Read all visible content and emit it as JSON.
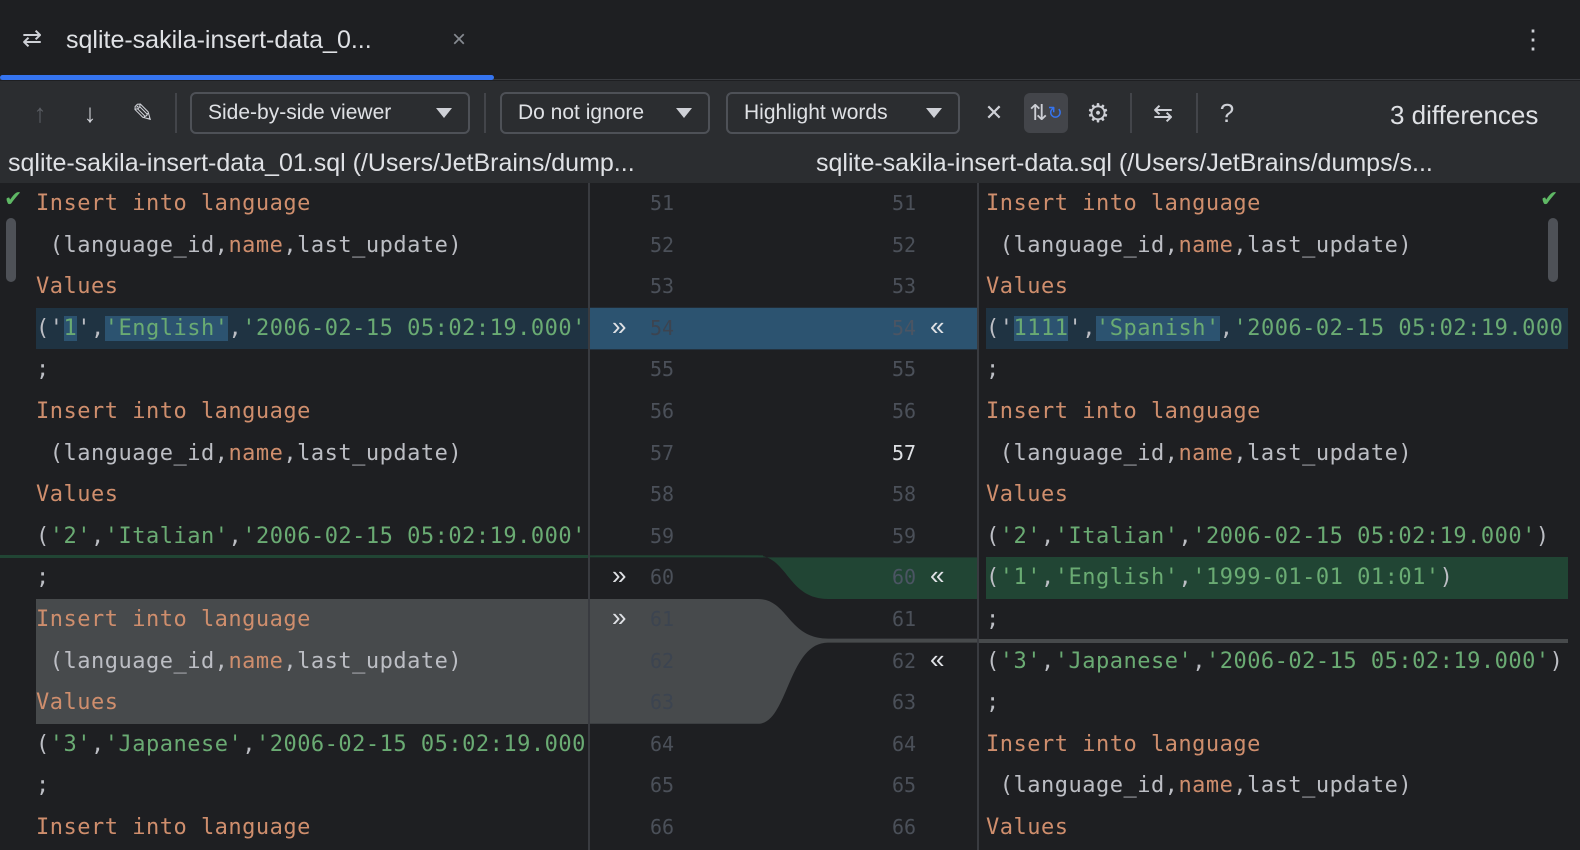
{
  "tab": {
    "title": "sqlite-sakila-insert-data_0...",
    "icon": "diff-arrows-icon",
    "close": "×"
  },
  "toolbar": {
    "viewer": "Side-by-side viewer",
    "ignore": "Do not ignore",
    "highlight": "Highlight words",
    "help": "?",
    "differences": "3 differences"
  },
  "files": {
    "left": "sqlite-sakila-insert-data_01.sql (/Users/JetBrains/dump...",
    "right": "sqlite-sakila-insert-data.sql (/Users/JetBrains/dumps/s..."
  },
  "colors": {
    "keyword": "#cf8e6d",
    "string": "#6aab73",
    "text": "#bcbec4",
    "modified": "#2c5370",
    "inserted": "#214534",
    "deleted": "#474a4c",
    "accent": "#3574f0"
  },
  "left_lines": [
    {
      "n": "51",
      "tokens": [
        [
          "k",
          "Insert into language"
        ]
      ]
    },
    {
      "n": "52",
      "tokens": [
        [
          "t",
          " (language_id,"
        ],
        [
          "k",
          "name"
        ],
        [
          "t",
          ",last_update)"
        ]
      ]
    },
    {
      "n": "53",
      "tokens": [
        [
          "k",
          "Values"
        ]
      ]
    },
    {
      "n": "54",
      "type": "modified",
      "tokens": [
        [
          "t",
          "('"
        ],
        [
          "s",
          "1"
        ],
        [
          "t",
          "',"
        ],
        [
          "s",
          "'English'"
        ],
        [
          "t",
          ","
        ],
        [
          "s",
          "'2006-02-15 05:02:19.000'"
        ],
        [
          "t",
          ")"
        ]
      ]
    },
    {
      "n": "55",
      "tokens": [
        [
          "t",
          ";"
        ]
      ]
    },
    {
      "n": "56",
      "tokens": [
        [
          "k",
          "Insert into language"
        ]
      ]
    },
    {
      "n": "57",
      "tokens": [
        [
          "t",
          " (language_id,"
        ],
        [
          "k",
          "name"
        ],
        [
          "t",
          ",last_update)"
        ]
      ]
    },
    {
      "n": "58",
      "tokens": [
        [
          "k",
          "Values"
        ]
      ]
    },
    {
      "n": "59",
      "tokens": [
        [
          "t",
          "("
        ],
        [
          "s",
          "'2'"
        ],
        [
          "t",
          ","
        ],
        [
          "s",
          "'Italian'"
        ],
        [
          "t",
          ","
        ],
        [
          "s",
          "'2006-02-15 05:02:19.000'"
        ],
        [
          "t",
          ")"
        ]
      ]
    },
    {
      "n": "60",
      "tokens": [
        [
          "t",
          ";"
        ]
      ]
    },
    {
      "n": "61",
      "type": "deleted",
      "tokens": [
        [
          "k",
          "Insert into language"
        ]
      ]
    },
    {
      "n": "62",
      "type": "deleted",
      "tokens": [
        [
          "t",
          " (language_id,"
        ],
        [
          "k",
          "name"
        ],
        [
          "t",
          ",last_update)"
        ]
      ]
    },
    {
      "n": "63",
      "type": "deleted",
      "tokens": [
        [
          "k",
          "Values"
        ]
      ]
    },
    {
      "n": "64",
      "tokens": [
        [
          "t",
          "("
        ],
        [
          "s",
          "'3'"
        ],
        [
          "t",
          ","
        ],
        [
          "s",
          "'Japanese'"
        ],
        [
          "t",
          ","
        ],
        [
          "s",
          "'2006-02-15 05:02:19.000'"
        ],
        [
          "t",
          ")"
        ]
      ]
    },
    {
      "n": "65",
      "tokens": [
        [
          "t",
          ";"
        ]
      ]
    },
    {
      "n": "66",
      "tokens": [
        [
          "k",
          "Insert into language"
        ]
      ]
    }
  ],
  "right_lines": [
    {
      "n": "51",
      "tokens": [
        [
          "k",
          "Insert into language"
        ]
      ]
    },
    {
      "n": "52",
      "tokens": [
        [
          "t",
          " (language_id,"
        ],
        [
          "k",
          "name"
        ],
        [
          "t",
          ",last_update)"
        ]
      ]
    },
    {
      "n": "53",
      "tokens": [
        [
          "k",
          "Values"
        ]
      ]
    },
    {
      "n": "54",
      "type": "modified",
      "tokens": [
        [
          "t",
          "('"
        ],
        [
          "s",
          "1111"
        ],
        [
          "t",
          "',"
        ],
        [
          "s",
          "'Spanish'"
        ],
        [
          "t",
          ","
        ],
        [
          "s",
          "'2006-02-15 05:02:19.000'"
        ],
        [
          "t",
          ")"
        ]
      ]
    },
    {
      "n": "55",
      "tokens": [
        [
          "t",
          ";"
        ]
      ]
    },
    {
      "n": "56",
      "tokens": [
        [
          "k",
          "Insert into language"
        ]
      ]
    },
    {
      "n": "57",
      "tokens": [
        [
          "t",
          " (language_id,"
        ],
        [
          "k",
          "name"
        ],
        [
          "t",
          ",last_update)"
        ]
      ]
    },
    {
      "n": "58",
      "tokens": [
        [
          "k",
          "Values"
        ]
      ]
    },
    {
      "n": "59",
      "tokens": [
        [
          "t",
          "("
        ],
        [
          "s",
          "'2'"
        ],
        [
          "t",
          ","
        ],
        [
          "s",
          "'Italian'"
        ],
        [
          "t",
          ","
        ],
        [
          "s",
          "'2006-02-15 05:02:19.000'"
        ],
        [
          "t",
          ")"
        ]
      ]
    },
    {
      "n": "60",
      "type": "inserted",
      "tokens": [
        [
          "t",
          "("
        ],
        [
          "s",
          "'1'"
        ],
        [
          "t",
          ","
        ],
        [
          "s",
          "'English'"
        ],
        [
          "t",
          ","
        ],
        [
          "s",
          "'1999-01-01 01:01'"
        ],
        [
          "t",
          ")"
        ]
      ]
    },
    {
      "n": "61",
      "tokens": [
        [
          "t",
          ";"
        ]
      ]
    },
    {
      "n": "62",
      "tokens": [
        [
          "t",
          "("
        ],
        [
          "s",
          "'3'"
        ],
        [
          "t",
          ","
        ],
        [
          "s",
          "'Japanese'"
        ],
        [
          "t",
          ","
        ],
        [
          "s",
          "'2006-02-15 05:02:19.000'"
        ],
        [
          "t",
          ")"
        ]
      ]
    },
    {
      "n": "63",
      "tokens": [
        [
          "t",
          ";"
        ]
      ]
    },
    {
      "n": "64",
      "tokens": [
        [
          "k",
          "Insert into language"
        ]
      ]
    },
    {
      "n": "65",
      "tokens": [
        [
          "t",
          " (language_id,"
        ],
        [
          "k",
          "name"
        ],
        [
          "t",
          ",last_update)"
        ]
      ]
    },
    {
      "n": "66",
      "tokens": [
        [
          "k",
          "Values"
        ]
      ]
    }
  ]
}
